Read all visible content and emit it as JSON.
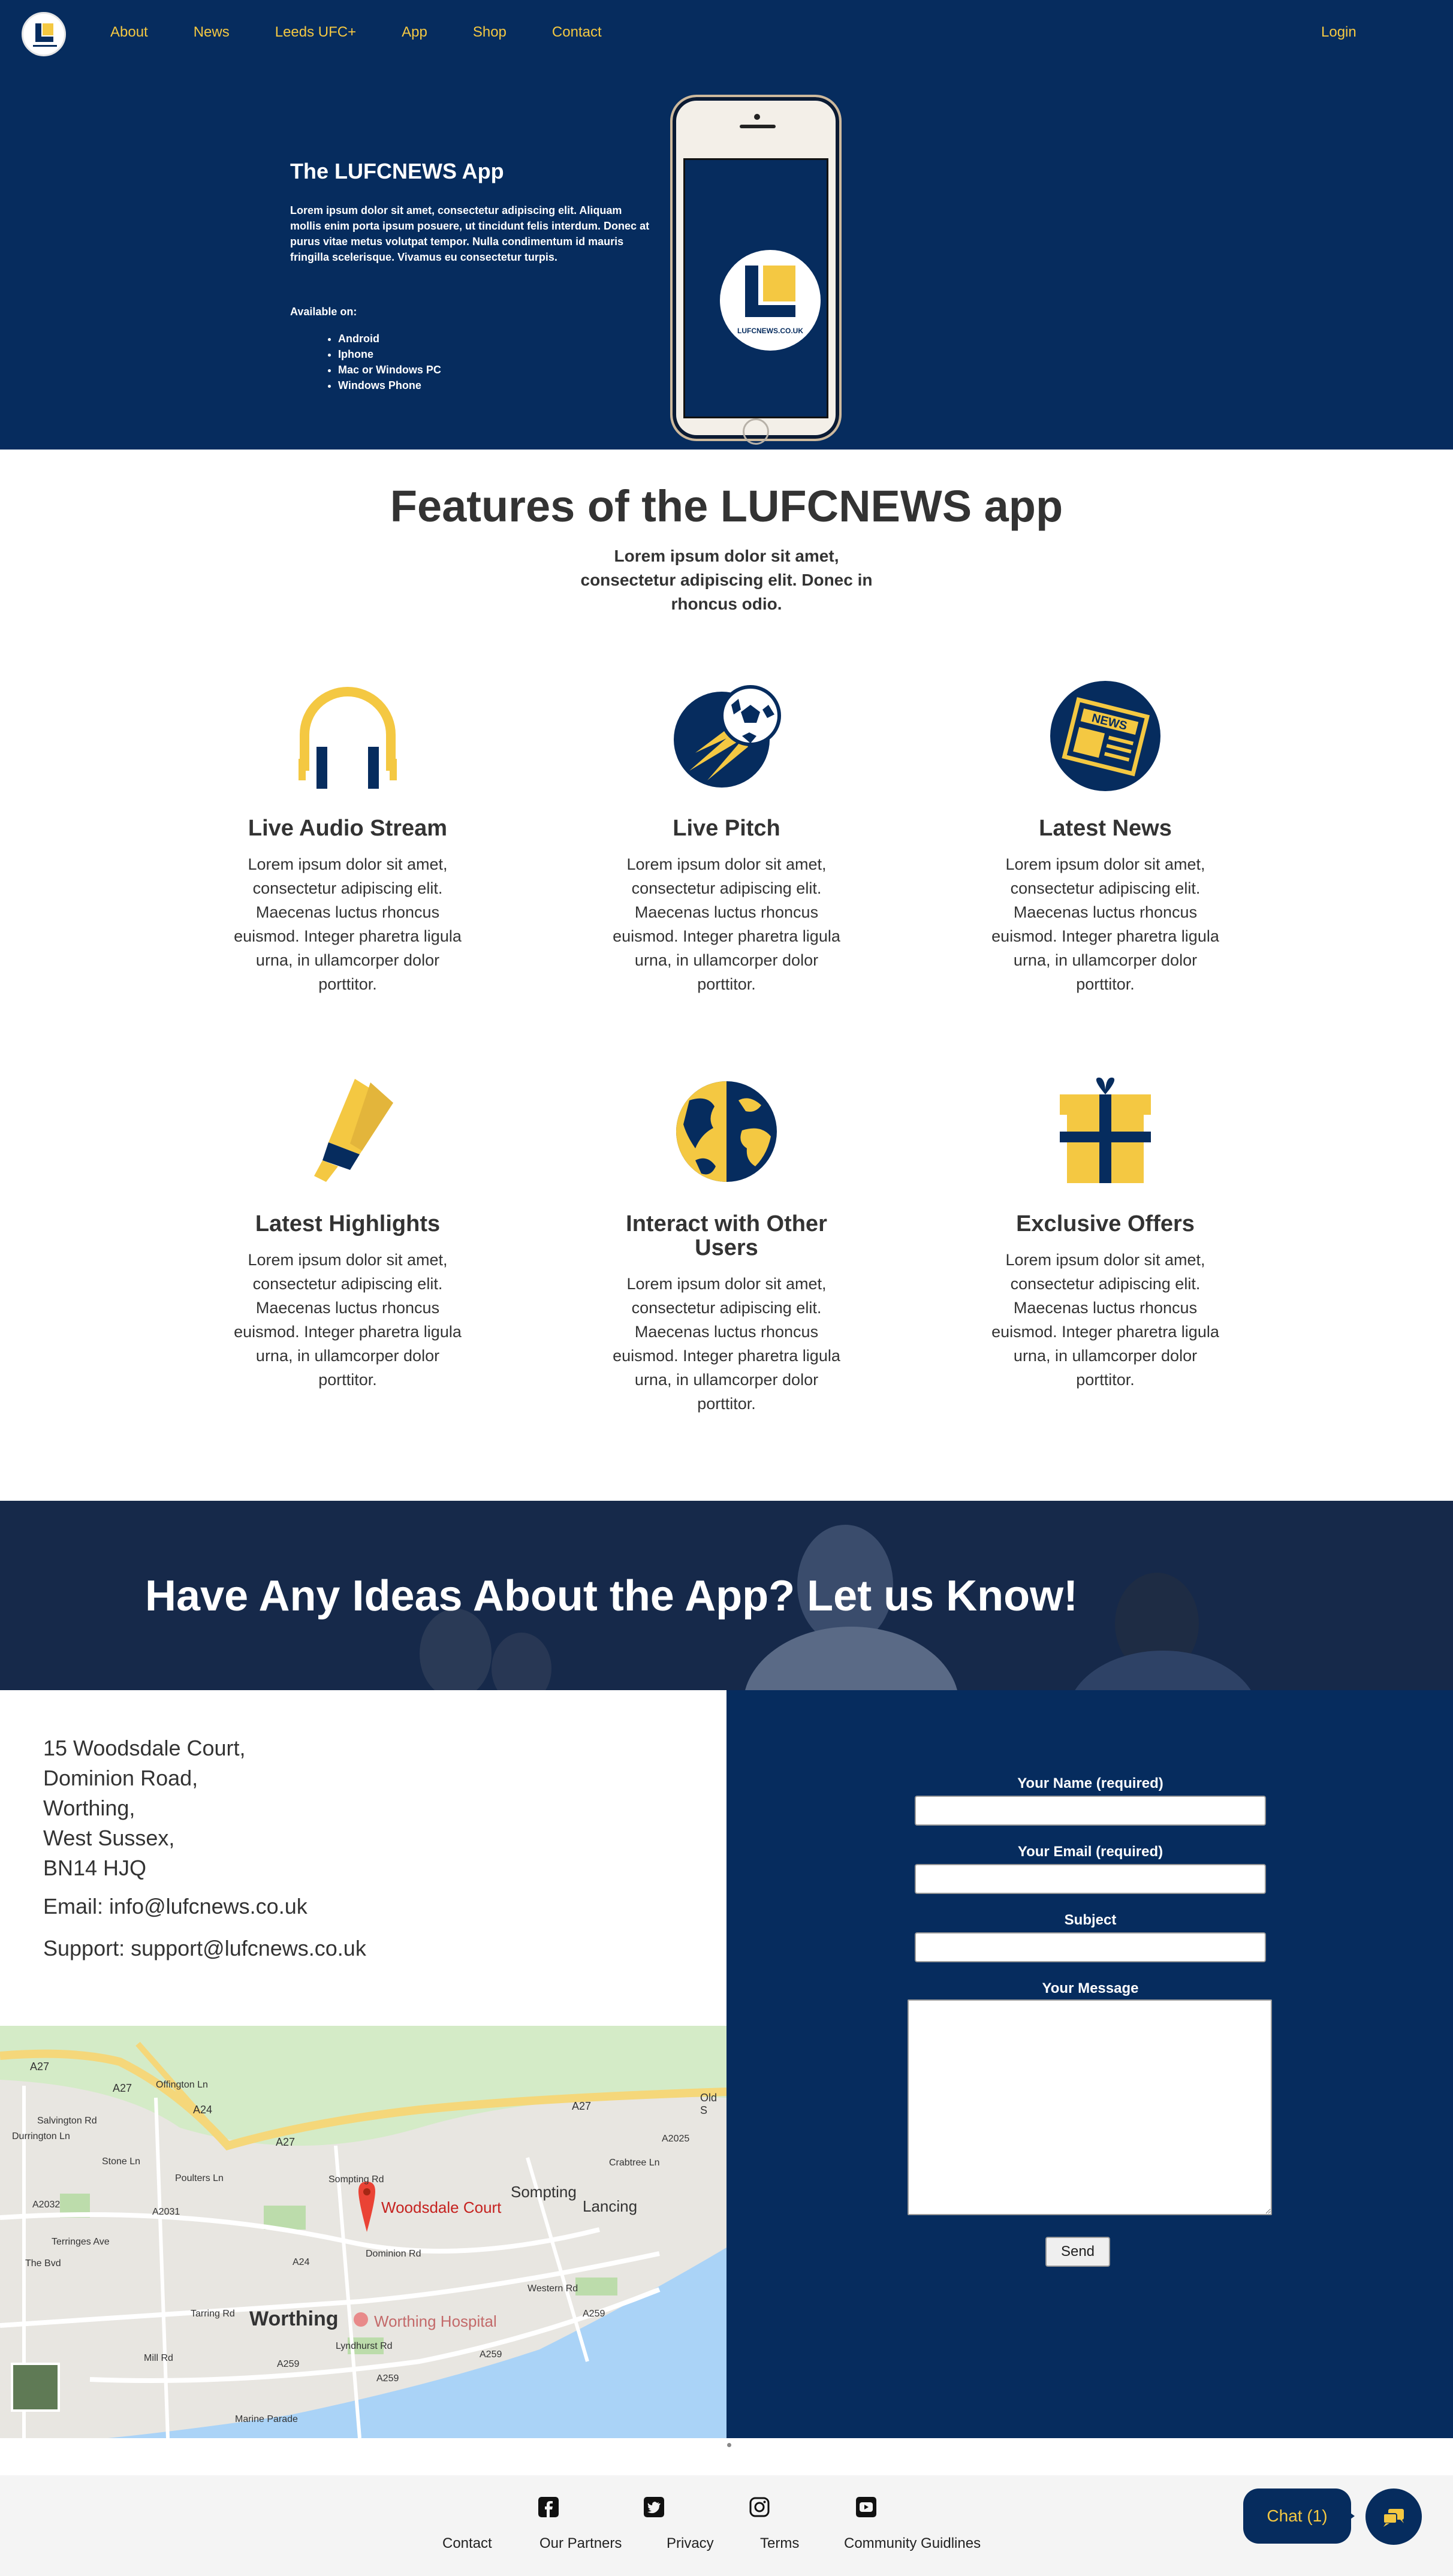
{
  "nav": {
    "links": [
      "About",
      "News",
      "Leeds UFC+",
      "App",
      "Shop",
      "Contact"
    ],
    "login": "Login",
    "logo_text": "LUFCNEWS.CO.UK"
  },
  "hero": {
    "title": "The LUFCNEWS App",
    "intro": "Lorem ipsum dolor sit amet, consectetur adipiscing elit. Aliquam mollis enim porta ipsum posuere, ut tincidunt felis interdum. Donec at purus vitae metus volutpat tempor. Nulla condimentum id mauris fringilla scelerisque. Vivamus eu consectetur turpis.",
    "available_label": "Available on:",
    "platforms": [
      "Android",
      "Iphone",
      "Mac or Windows PC",
      "Windows Phone"
    ],
    "phone_caption": "LUFCNEWS.CO.UK"
  },
  "features": {
    "title": "Features of the LUFCNEWS app",
    "subtitle": "Lorem ipsum dolor sit amet, consectetur adipiscing elit. Donec in rhoncus odio.",
    "items": [
      {
        "icon": "headphones-icon",
        "title": "Live Audio Stream",
        "text": "Lorem ipsum dolor sit amet, consectetur adipiscing elit. Maecenas luctus rhoncus euismod. Integer pharetra ligula urna, in ullamcorper dolor porttitor."
      },
      {
        "icon": "football-icon",
        "title": "Live Pitch",
        "text": "Lorem ipsum dolor sit amet, consectetur adipiscing elit. Maecenas luctus rhoncus euismod. Integer pharetra ligula urna, in ullamcorper dolor porttitor."
      },
      {
        "icon": "newspaper-icon",
        "title": "Latest News",
        "text": "Lorem ipsum dolor sit amet, consectetur adipiscing elit. Maecenas luctus rhoncus euismod. Integer pharetra ligula urna, in ullamcorper dolor porttitor.",
        "badge": "NEWS"
      },
      {
        "icon": "highlighter-icon",
        "title": "Latest Highlights",
        "text": "Lorem ipsum dolor sit amet, consectetur adipiscing elit. Maecenas luctus rhoncus euismod. Integer pharetra ligula urna, in ullamcorper dolor porttitor."
      },
      {
        "icon": "globe-icon",
        "title": "Interact with Other Users",
        "text": "Lorem ipsum dolor sit amet, consectetur adipiscing elit. Maecenas luctus rhoncus euismod. Integer pharetra ligula urna, in ullamcorper dolor porttitor."
      },
      {
        "icon": "gift-icon",
        "title": "Exclusive Offers",
        "text": "Lorem ipsum dolor sit amet, consectetur adipiscing elit. Maecenas luctus rhoncus euismod. Integer pharetra ligula urna, in ullamcorper dolor porttitor."
      }
    ]
  },
  "banner": {
    "title": "Have Any Ideas About the App? Let us Know!"
  },
  "contact": {
    "address": [
      "15 Woodsdale Court,",
      "Dominion Road,",
      "Worthing,",
      "West Sussex,",
      "BN14 HJQ"
    ],
    "email": "Email: info@lufcnews.co.uk",
    "support": "Support: support@lufcnews.co.uk"
  },
  "form": {
    "name_label": "Your Name (required)",
    "email_label": "Your Email (required)",
    "subject_label": "Subject",
    "message_label": "Your Message",
    "send_label": "Send"
  },
  "map": {
    "marker_label": "Woodsdale Court",
    "hospital_label": "Worthing Hospital",
    "town_labels": [
      "Worthing",
      "Sompting",
      "Lancing"
    ],
    "road_labels": [
      "A27",
      "A27",
      "A24",
      "A27",
      "A27",
      "Old S",
      "Salvington Rd",
      "Poulters Ln",
      "A2032",
      "Terringes Ave",
      "Tarring Rd",
      "Mill Rd",
      "A259",
      "A259",
      "A259",
      "Marine Parade",
      "Dominion Rd",
      "Lyndhurst Rd",
      "Crabtree Ln",
      "A2025",
      "Western Rd",
      "A259",
      "Offington Ln",
      "Stone Ln",
      "Durrington Ln",
      "A2031",
      "The Bvd",
      "A24",
      "Sompting Rd"
    ]
  },
  "footer": {
    "icons": [
      "facebook-icon",
      "twitter-icon",
      "instagram-icon",
      "youtube-icon"
    ],
    "links": [
      "Contact",
      "Our Partners",
      "Privacy",
      "Terms",
      "Community Guidlines"
    ],
    "chat_label": "Chat (1)"
  },
  "colors": {
    "navy": "#062c5e",
    "gold": "#f4c842",
    "text": "#333333"
  }
}
